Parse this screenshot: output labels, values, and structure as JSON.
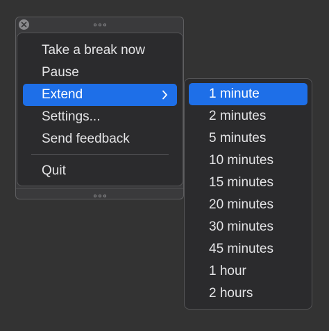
{
  "main_menu": {
    "items": [
      {
        "label": "Take a break now"
      },
      {
        "label": "Pause"
      },
      {
        "label": "Extend"
      },
      {
        "label": "Settings..."
      },
      {
        "label": "Send feedback"
      },
      {
        "label": "Quit"
      }
    ],
    "highlighted": "Extend"
  },
  "submenu": {
    "items": [
      {
        "label": "1 minute"
      },
      {
        "label": "2 minutes"
      },
      {
        "label": "5 minutes"
      },
      {
        "label": "10 minutes"
      },
      {
        "label": "15 minutes"
      },
      {
        "label": "20 minutes"
      },
      {
        "label": "30 minutes"
      },
      {
        "label": "45 minutes"
      },
      {
        "label": "1 hour"
      },
      {
        "label": "2 hours"
      }
    ],
    "highlighted": "1 minute"
  },
  "icons": {
    "close": "close-icon",
    "chevron": "chevron-right-icon",
    "grip": "drag-handle-icon"
  },
  "colors": {
    "accent": "#1e6fe8",
    "background": "#333333",
    "menu_background": "#2b2b2d"
  }
}
